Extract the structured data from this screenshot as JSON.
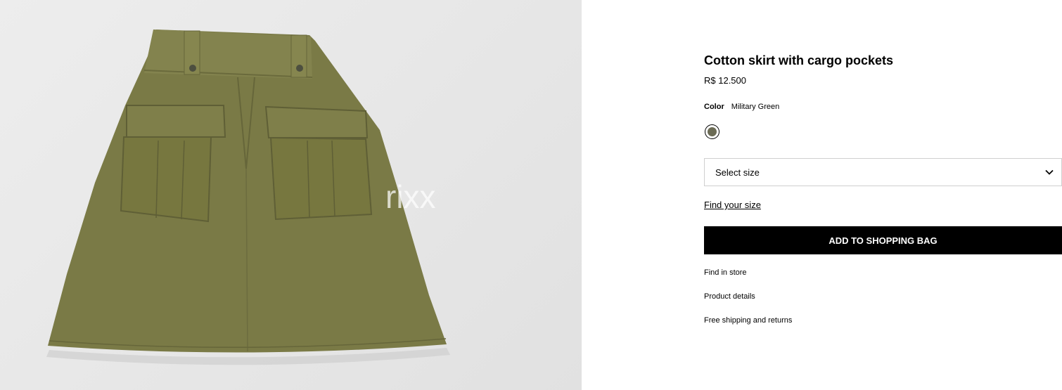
{
  "product": {
    "title": "Cotton skirt with cargo pockets",
    "price": "R$ 12.500",
    "color_label": "Color",
    "color_value": "Military Green",
    "swatch_color": "#6b6b55",
    "image_watermark": "rixx"
  },
  "size_select": {
    "label": "Select size",
    "icon": "chevron-down-icon"
  },
  "links": {
    "find_size": "Find your size",
    "find_in_store": "Find in store",
    "product_details": "Product details",
    "shipping": "Free shipping and returns"
  },
  "actions": {
    "add_to_bag": "ADD TO SHOPPING BAG"
  },
  "colors": {
    "fabric": "#7a7a46",
    "button_bg": "#000000",
    "image_bg": "#e8e8e8"
  }
}
